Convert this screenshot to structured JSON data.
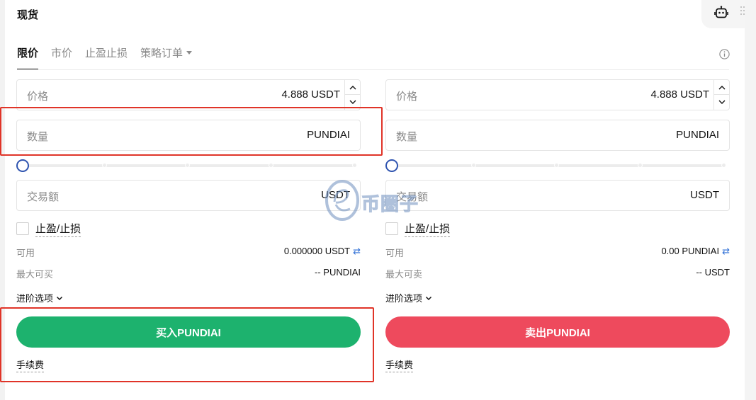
{
  "header": {
    "title": "现货"
  },
  "tabs": [
    {
      "label": "限价",
      "active": true
    },
    {
      "label": "市价",
      "active": false
    },
    {
      "label": "止盈止损",
      "active": false
    },
    {
      "label": "策略订单",
      "active": false
    }
  ],
  "buy": {
    "price_label": "价格",
    "price_value": "4.888 USDT",
    "amount_label": "数量",
    "amount_unit": "PUNDIAI",
    "total_label": "交易额",
    "total_unit": "USDT",
    "slider_percent": 0,
    "tpsl_label": "止盈/止损",
    "available_label": "可用",
    "available_value": "0.000000 USDT",
    "max_label": "最大可买",
    "max_value": "-- PUNDIAI",
    "advanced_label": "进阶选项",
    "action_label": "买入PUNDIAI",
    "fee_label": "手续费"
  },
  "sell": {
    "price_label": "价格",
    "price_value": "4.888 USDT",
    "amount_label": "数量",
    "amount_unit": "PUNDIAI",
    "total_label": "交易额",
    "total_unit": "USDT",
    "slider_percent": 0,
    "tpsl_label": "止盈/止损",
    "available_label": "可用",
    "available_value": "0.00 PUNDIAI",
    "max_label": "最大可卖",
    "max_value": "-- USDT",
    "advanced_label": "进阶选项",
    "action_label": "卖出PUNDIAI",
    "fee_label": "手续费"
  },
  "colors": {
    "buy": "#1db26e",
    "sell": "#ee4a5d",
    "highlight": "#e03428",
    "slider_thumb": "#2f54b0"
  },
  "icons": {
    "assistant": "robot-icon",
    "info": "info-icon",
    "swap": "swap-arrows-icon",
    "advanced": "chevron-down-icon"
  },
  "watermark": {
    "text": "币圈子"
  }
}
